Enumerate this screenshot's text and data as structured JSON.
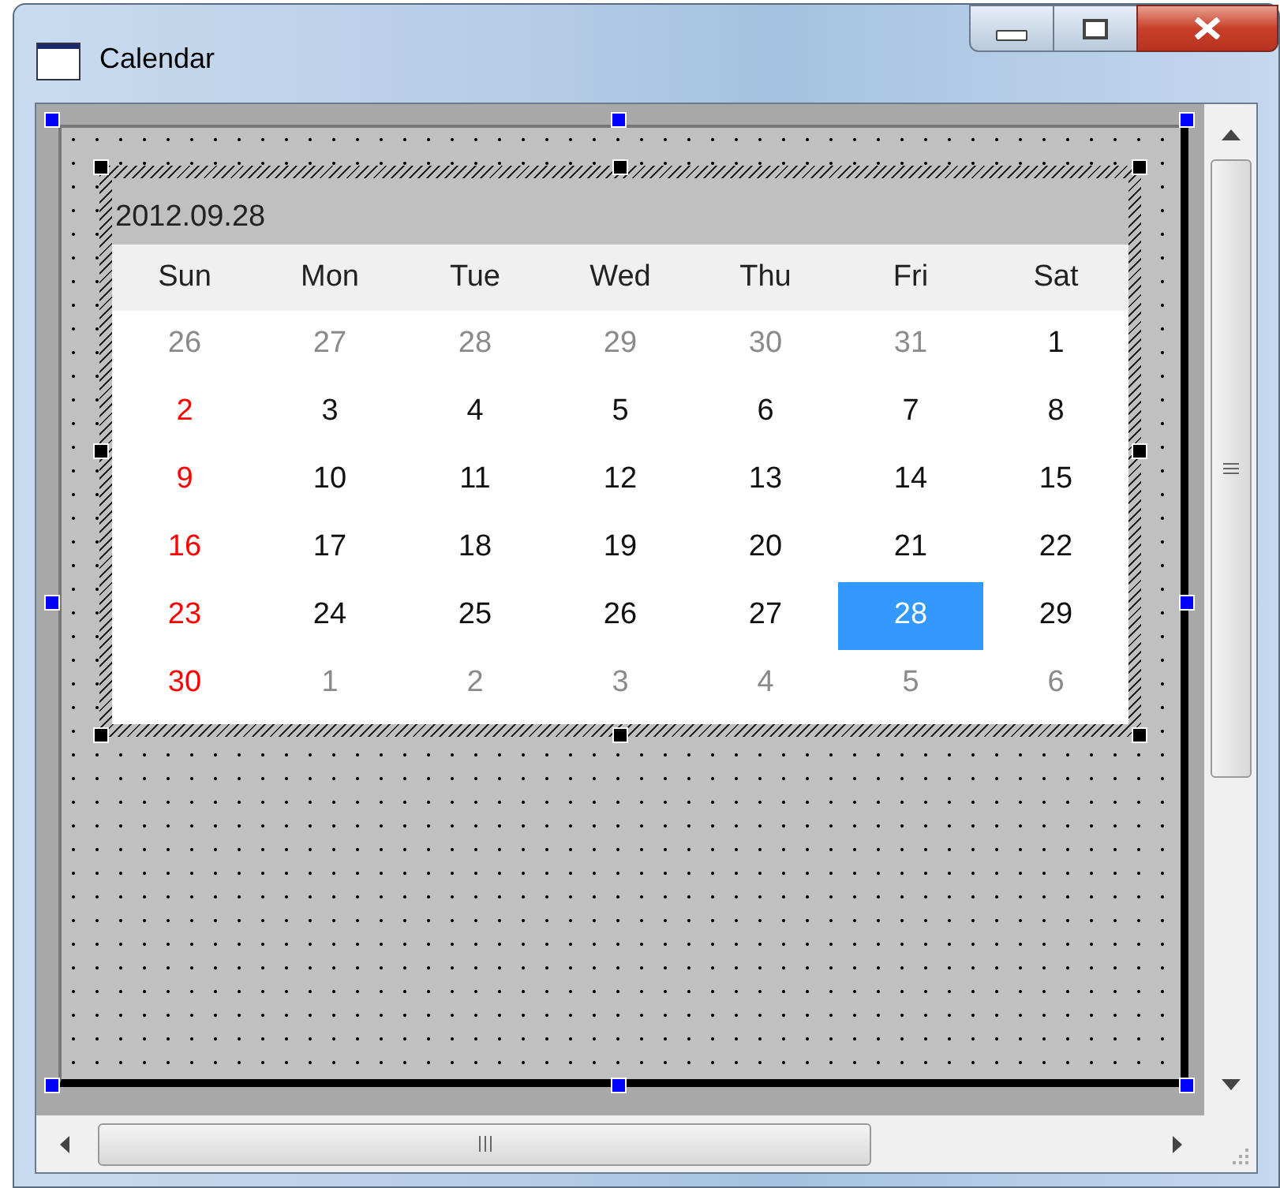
{
  "window": {
    "title": "Calendar"
  },
  "calendar": {
    "date": "2012.09.28",
    "weekdays": [
      "Sun",
      "Mon",
      "Tue",
      "Wed",
      "Thu",
      "Fri",
      "Sat"
    ],
    "weeks": [
      [
        {
          "label": "26",
          "kind": "outside",
          "selected": false
        },
        {
          "label": "27",
          "kind": "outside",
          "selected": false
        },
        {
          "label": "28",
          "kind": "outside",
          "selected": false
        },
        {
          "label": "29",
          "kind": "outside",
          "selected": false
        },
        {
          "label": "30",
          "kind": "outside",
          "selected": false
        },
        {
          "label": "31",
          "kind": "outside",
          "selected": false
        },
        {
          "label": "1",
          "kind": "weekday",
          "selected": false
        }
      ],
      [
        {
          "label": "2",
          "kind": "sunday",
          "selected": false
        },
        {
          "label": "3",
          "kind": "weekday",
          "selected": false
        },
        {
          "label": "4",
          "kind": "weekday",
          "selected": false
        },
        {
          "label": "5",
          "kind": "weekday",
          "selected": false
        },
        {
          "label": "6",
          "kind": "weekday",
          "selected": false
        },
        {
          "label": "7",
          "kind": "weekday",
          "selected": false
        },
        {
          "label": "8",
          "kind": "weekday",
          "selected": false
        }
      ],
      [
        {
          "label": "9",
          "kind": "sunday",
          "selected": false
        },
        {
          "label": "10",
          "kind": "weekday",
          "selected": false
        },
        {
          "label": "11",
          "kind": "weekday",
          "selected": false
        },
        {
          "label": "12",
          "kind": "weekday",
          "selected": false
        },
        {
          "label": "13",
          "kind": "weekday",
          "selected": false
        },
        {
          "label": "14",
          "kind": "weekday",
          "selected": false
        },
        {
          "label": "15",
          "kind": "weekday",
          "selected": false
        }
      ],
      [
        {
          "label": "16",
          "kind": "sunday",
          "selected": false
        },
        {
          "label": "17",
          "kind": "weekday",
          "selected": false
        },
        {
          "label": "18",
          "kind": "weekday",
          "selected": false
        },
        {
          "label": "19",
          "kind": "weekday",
          "selected": false
        },
        {
          "label": "20",
          "kind": "weekday",
          "selected": false
        },
        {
          "label": "21",
          "kind": "weekday",
          "selected": false
        },
        {
          "label": "22",
          "kind": "weekday",
          "selected": false
        }
      ],
      [
        {
          "label": "23",
          "kind": "sunday",
          "selected": false
        },
        {
          "label": "24",
          "kind": "weekday",
          "selected": false
        },
        {
          "label": "25",
          "kind": "weekday",
          "selected": false
        },
        {
          "label": "26",
          "kind": "weekday",
          "selected": false
        },
        {
          "label": "27",
          "kind": "weekday",
          "selected": false
        },
        {
          "label": "28",
          "kind": "weekday",
          "selected": true
        },
        {
          "label": "29",
          "kind": "weekday",
          "selected": false
        }
      ],
      [
        {
          "label": "30",
          "kind": "sunday",
          "selected": false
        },
        {
          "label": "1",
          "kind": "outside",
          "selected": false
        },
        {
          "label": "2",
          "kind": "outside",
          "selected": false
        },
        {
          "label": "3",
          "kind": "outside",
          "selected": false
        },
        {
          "label": "4",
          "kind": "outside",
          "selected": false
        },
        {
          "label": "5",
          "kind": "outside",
          "selected": false
        },
        {
          "label": "6",
          "kind": "outside",
          "selected": false
        }
      ]
    ]
  }
}
